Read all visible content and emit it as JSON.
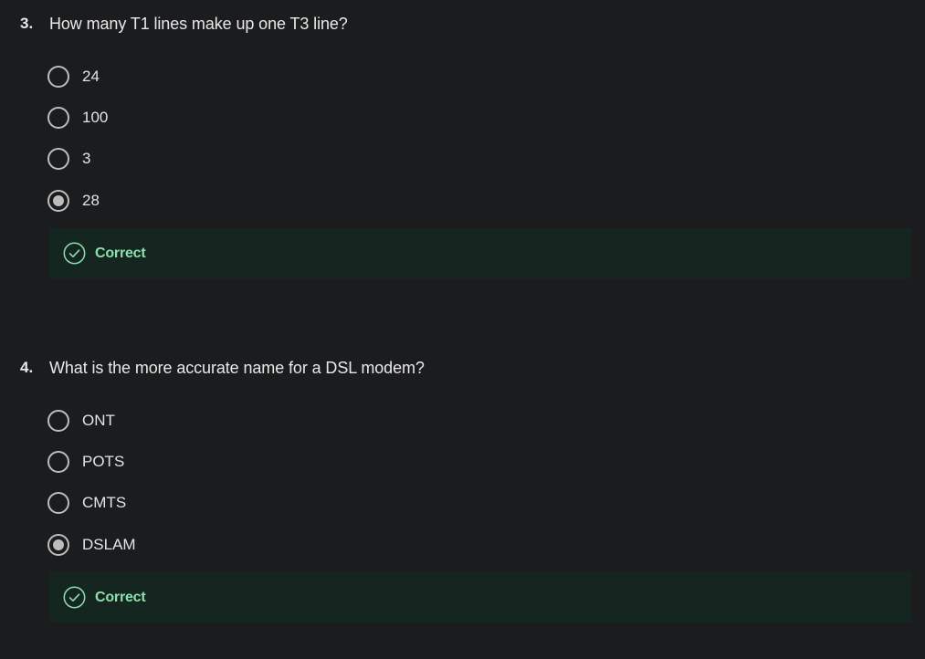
{
  "questions": [
    {
      "number": "3.",
      "text": "How many T1 lines make up one T3 line?",
      "options": [
        {
          "label": "24",
          "selected": false
        },
        {
          "label": "100",
          "selected": false
        },
        {
          "label": "3",
          "selected": false
        },
        {
          "label": "28",
          "selected": true
        }
      ],
      "feedback": {
        "text": "Correct",
        "icon": "check-circle-icon",
        "color": "#8be0ad",
        "background": "#152620"
      }
    },
    {
      "number": "4.",
      "text": "What is the more accurate name for a DSL modem?",
      "options": [
        {
          "label": "ONT",
          "selected": false
        },
        {
          "label": "POTS",
          "selected": false
        },
        {
          "label": "CMTS",
          "selected": false
        },
        {
          "label": "DSLAM",
          "selected": true
        }
      ],
      "feedback": {
        "text": "Correct",
        "icon": "check-circle-icon",
        "color": "#8be0ad",
        "background": "#152620"
      }
    }
  ],
  "theme": {
    "background": "#1b1c1e",
    "radio_color": "#bdbdbd",
    "text_color": "#e3e3e3"
  }
}
